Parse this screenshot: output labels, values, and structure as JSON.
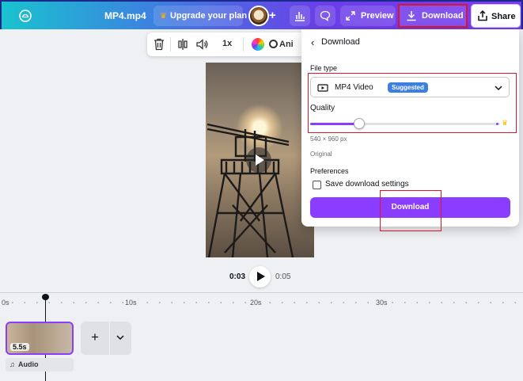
{
  "topbar": {
    "filename": "MP4.mp4",
    "upgrade_label": "Upgrade your plan",
    "preview_label": "Preview",
    "download_label": "Download",
    "share_label": "Share"
  },
  "toolbar": {
    "speed_label": "1x",
    "animate_label": "Ani"
  },
  "player": {
    "current_time": "0:03",
    "total_time": "0:05"
  },
  "timeline": {
    "ticks": [
      "0s",
      "10s",
      "20s",
      "30s"
    ],
    "clip_duration": "5.5s",
    "audio_label": "Audio"
  },
  "download_panel": {
    "title": "Download",
    "file_type_label": "File type",
    "file_type_value": "MP4 Video",
    "suggested_badge": "Suggested",
    "quality_label": "Quality",
    "quality_level": 0.26,
    "resolution": "540 × 960 px",
    "original_label": "Original",
    "preferences_label": "Preferences",
    "save_settings_label": "Save download settings",
    "save_settings_checked": false,
    "download_button": "Download"
  },
  "colors": {
    "accent": "#8b3dff",
    "highlight": "#e0152a",
    "badge": "#3d7fe0"
  }
}
